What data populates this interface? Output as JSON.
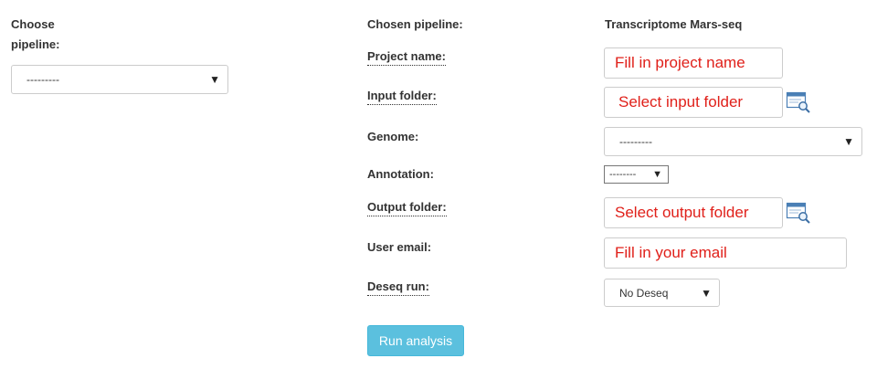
{
  "left": {
    "choose_label_line1": "Choose",
    "choose_label_line2": "pipeline:",
    "pipeline_select_value": "---------"
  },
  "form": {
    "chosen_pipeline_label": "Chosen pipeline:",
    "chosen_pipeline_value": "Transcriptome Mars-seq",
    "project_name_label": "Project name:",
    "project_name_placeholder": "Fill in project name",
    "input_folder_label": "Input folder:",
    "input_folder_placeholder": "Select input folder",
    "genome_label": "Genome:",
    "genome_value": "---------",
    "annotation_label": "Annotation:",
    "annotation_value": "--------",
    "output_folder_label": "Output folder:",
    "output_folder_placeholder": "Select output folder",
    "user_email_label": "User email:",
    "user_email_placeholder": "Fill in your email",
    "deseq_label": "Deseq run:",
    "deseq_value": "No Deseq",
    "run_button_label": "Run analysis"
  },
  "icons": {
    "arrow": "dropdown-arrow-icon",
    "browse": "folder-browse-icon"
  },
  "colors": {
    "placeholder_red": "#e0201a",
    "button_blue": "#5bc0de"
  }
}
